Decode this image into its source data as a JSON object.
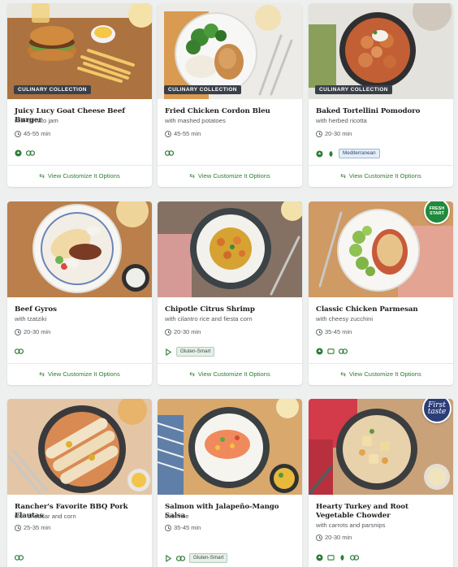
{
  "recipes": [
    {
      "title": "Juicy Lucy Goat Cheese Beef Burger",
      "subtitle": "with tomato jam",
      "time": "45-55 min",
      "badge": "CULINARY COLLECTION",
      "tags": [],
      "cta": "View Customize It Options"
    },
    {
      "title": "Fried Chicken Cordon Bleu",
      "subtitle": "with mashed potatoes",
      "time": "45-55 min",
      "badge": "CULINARY COLLECTION",
      "tags": [],
      "cta": "View Customize It Options"
    },
    {
      "title": "Baked Tortellini Pomodoro",
      "subtitle": "with herbed ricotta",
      "time": "20-30 min",
      "badge": "CULINARY COLLECTION",
      "tags": [
        "Mediterranean"
      ],
      "cta": "View Customize It Options"
    },
    {
      "title": "Beef Gyros",
      "subtitle": "with tzatziki",
      "time": "20-30 min",
      "badge": "",
      "tags": [],
      "cta": "View Customize It Options"
    },
    {
      "title": "Chipotle Citrus Shrimp",
      "subtitle": "with cilantro rice and fiesta corn",
      "time": "20-30 min",
      "badge": "",
      "tags": [
        "Gluten-Smart"
      ],
      "cta": "View Customize It Options"
    },
    {
      "title": "Classic Chicken Parmesan",
      "subtitle": "with cheesy zucchini",
      "time": "35-45 min",
      "badge": "",
      "tags": [],
      "stamp": "FRESH START",
      "cta": "View Customize It Options"
    },
    {
      "title": "Rancher's Favorite BBQ Pork Flautas",
      "subtitle": "with cheddar and corn",
      "time": "25-35 min",
      "badge": "",
      "tags": []
    },
    {
      "title": "Salmon with Jalapeño-Mango Salsa",
      "subtitle": "over rice",
      "time": "35-45 min",
      "badge": "",
      "tags": [
        "Gluten-Smart"
      ]
    },
    {
      "title": "Hearty Turkey and Root Vegetable Chowder",
      "subtitle": "with carrots and parsnips",
      "time": "20-30 min",
      "badge": "",
      "tags": [],
      "stamp": "First taste"
    }
  ],
  "icons": {
    "clock": "clock-icon",
    "swap": "swap-arrows-icon",
    "diet": "diet-icon",
    "calorie": "calorie-smart-icon",
    "protein": "protein-swap-icon",
    "carb": "carb-smart-icon"
  },
  "colors": {
    "accent_green": "#2e7d32",
    "badge_bg": "#3a4049",
    "page_bg": "#eef0f0",
    "stamp_green": "#1f8a3c",
    "stamp_navy": "#2c3e78"
  }
}
